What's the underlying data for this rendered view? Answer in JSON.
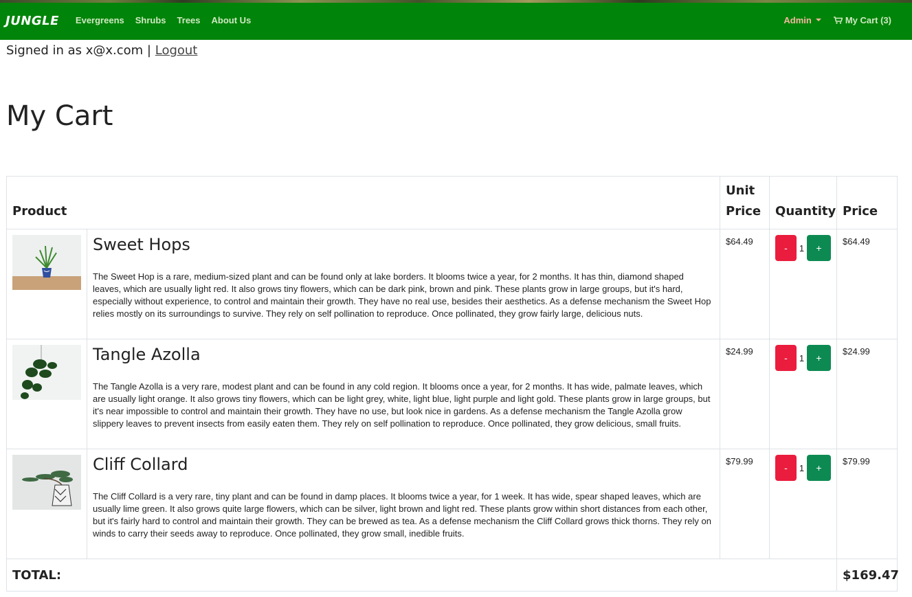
{
  "nav": {
    "brand": "JUNGLE",
    "links": [
      "Evergreens",
      "Shrubs",
      "Trees",
      "About Us"
    ],
    "admin_label": "Admin",
    "cart_label": "My Cart (3)"
  },
  "session": {
    "signed_in_text": "Signed in as x@x.com |",
    "logout_label": "Logout"
  },
  "page": {
    "title": "My Cart"
  },
  "table": {
    "headers": {
      "product": "Product",
      "unit_price": "Unit Price",
      "quantity": "Quantity",
      "price": "Price"
    },
    "rows": [
      {
        "name": "Sweet Hops",
        "description": "The Sweet Hop is a rare, medium-sized plant and can be found only at lake borders. It blooms twice a year, for 2 months. It has thin, diamond shaped leaves, which are usually light red. It also grows tiny flowers, which can be dark pink, brown and pink. These plants grow in large groups, but it's hard, especially without experience, to control and maintain their growth. They have no real use, besides their aesthetics. As a defense mechanism the Sweet Hop relies mostly on its surroundings to survive. They rely on self pollination to reproduce. Once pollinated, they grow fairly large, delicious nuts.",
        "unit_price": "$64.49",
        "quantity": "1",
        "price": "$64.49",
        "minus": "-",
        "plus": "+"
      },
      {
        "name": "Tangle Azolla",
        "description": "The Tangle Azolla is a very rare, modest plant and can be found in any cold region. It blooms once a year, for 2 months. It has wide, palmate leaves, which are usually light orange. It also grows tiny flowers, which can be light grey, white, light blue, light purple and light gold. These plants grow in large groups, but it's near impossible to control and maintain their growth. They have no use, but look nice in gardens. As a defense mechanism the Tangle Azolla grow slippery leaves to prevent insects from easily eaten them. They rely on self pollination to reproduce. Once pollinated, they grow delicious, small fruits.",
        "unit_price": "$24.99",
        "quantity": "1",
        "price": "$24.99",
        "minus": "-",
        "plus": "+"
      },
      {
        "name": "Cliff Collard",
        "description": "The Cliff Collard is a very rare, tiny plant and can be found in damp places. It blooms twice a year, for 1 week. It has wide, spear shaped leaves, which are usually lime green. It also grows quite large flowers, which can be silver, light brown and light red. These plants grow within short distances from each other, but it's fairly hard to control and maintain their growth. They can be brewed as tea. As a defense mechanism the Cliff Collard grows thick thorns. They rely on winds to carry their seeds away to reproduce. Once pollinated, they grow small, inedible fruits.",
        "unit_price": "$79.99",
        "quantity": "1",
        "price": "$79.99",
        "minus": "-",
        "plus": "+"
      }
    ],
    "total_label": "TOTAL:",
    "total_value": "$169.47"
  },
  "colors": {
    "navbar": "#008409",
    "minus_button": "#ea1d3e",
    "plus_button": "#0d8a52",
    "admin_link": "#f5b8a0"
  }
}
